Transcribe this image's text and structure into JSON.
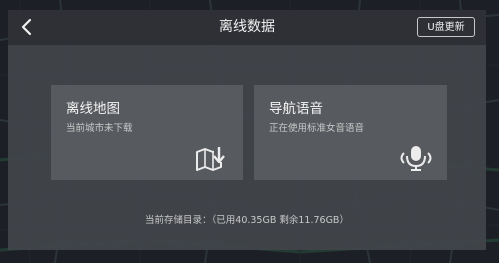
{
  "header": {
    "title": "离线数据",
    "udisk_update_label": "U盘更新"
  },
  "cards": [
    {
      "title": "离线地图",
      "subtitle": "当前城市未下载",
      "icon": "map-download-icon"
    },
    {
      "title": "导航语音",
      "subtitle": "正在使用标准女音语音",
      "icon": "voice-microphone-icon"
    }
  ],
  "storage_text": "当前存储目录：（已用40.35GB 剩余11.76GB）",
  "colors": {
    "panel": "#42454a",
    "header": "#2e3034",
    "card": "#575a5f",
    "text": "#f4f4f4",
    "subtext": "#c9c9c9"
  }
}
